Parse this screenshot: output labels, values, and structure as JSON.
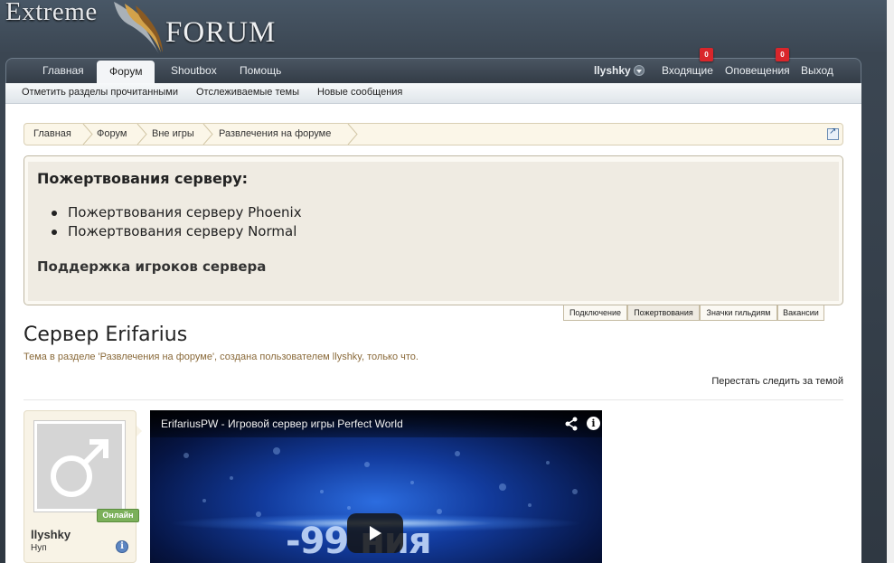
{
  "header": {
    "logo_left": "Extreme",
    "logo_right": "FORUM"
  },
  "nav": {
    "tabs": [
      "Главная",
      "Форум",
      "Shoutbox",
      "Помощь"
    ],
    "active_tab": "Форум",
    "username": "llyshky",
    "inbox_label": "Входящие",
    "inbox_count": "0",
    "alerts_label": "Оповещения",
    "alerts_count": "0",
    "logout_label": "Выход"
  },
  "subnav": {
    "links": [
      "Отметить разделы прочитанными",
      "Отслеживаемые темы",
      "Новые сообщения"
    ]
  },
  "breadcrumb": [
    "Главная",
    "Форум",
    "Вне игры",
    "Развлечения на форуме"
  ],
  "notice": {
    "title": "Пожертвования серверу:",
    "items": [
      "Пожертвования серверу Phoenix",
      "Пожертвования серверу Normal"
    ],
    "subtitle": "Поддержка игроков сервера",
    "tabs": [
      "Подключение",
      "Пожертвования",
      "Значки гильдиям",
      "Вакансии"
    ],
    "active_tab": "Пожертвования"
  },
  "thread": {
    "title": "Сервер Erifarius",
    "meta": "Тема в разделе 'Развлечения на форуме', создана пользователем llyshky, только что.",
    "unwatch_label": "Перестать следить за темой"
  },
  "post": {
    "author": "llyshky",
    "rank": "Нуп",
    "status": "Онлайн",
    "video_title": "ErifariusPW - Игровой сервер игры Perfect World",
    "video_overlay_text": "-99 ния"
  },
  "colors": {
    "accent_nav": "#3b4652",
    "badge": "#d9262b",
    "online": "#7bb05a",
    "meta_text": "#8a6a3a"
  }
}
